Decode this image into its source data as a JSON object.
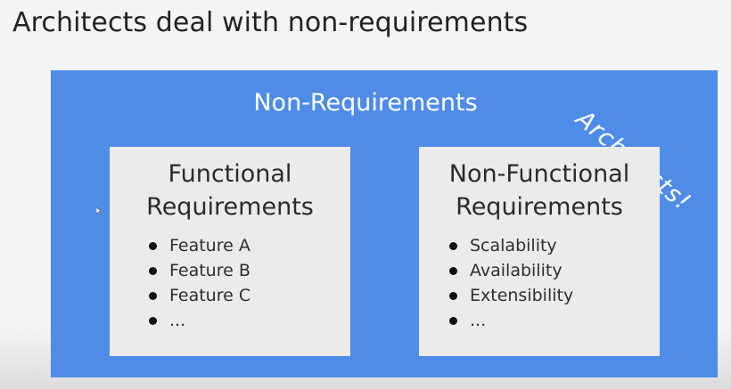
{
  "slide": {
    "title": "Architects deal with non-requirements"
  },
  "diagram": {
    "outer_label": "Non-Requirements",
    "corner_note": "Architects!",
    "colors": {
      "panel": "#4f8ce8",
      "card": "#ebebeb",
      "panel_text": "#ffffff"
    },
    "cards": [
      {
        "title_line1": "Functional",
        "title_line2": "Requirements",
        "items": [
          "Feature A",
          "Feature B",
          "Feature C",
          "..."
        ]
      },
      {
        "title_line1": "Non-Functional",
        "title_line2": "Requirements",
        "items": [
          "Scalability",
          "Availability",
          "Extensibility",
          "..."
        ]
      }
    ]
  }
}
